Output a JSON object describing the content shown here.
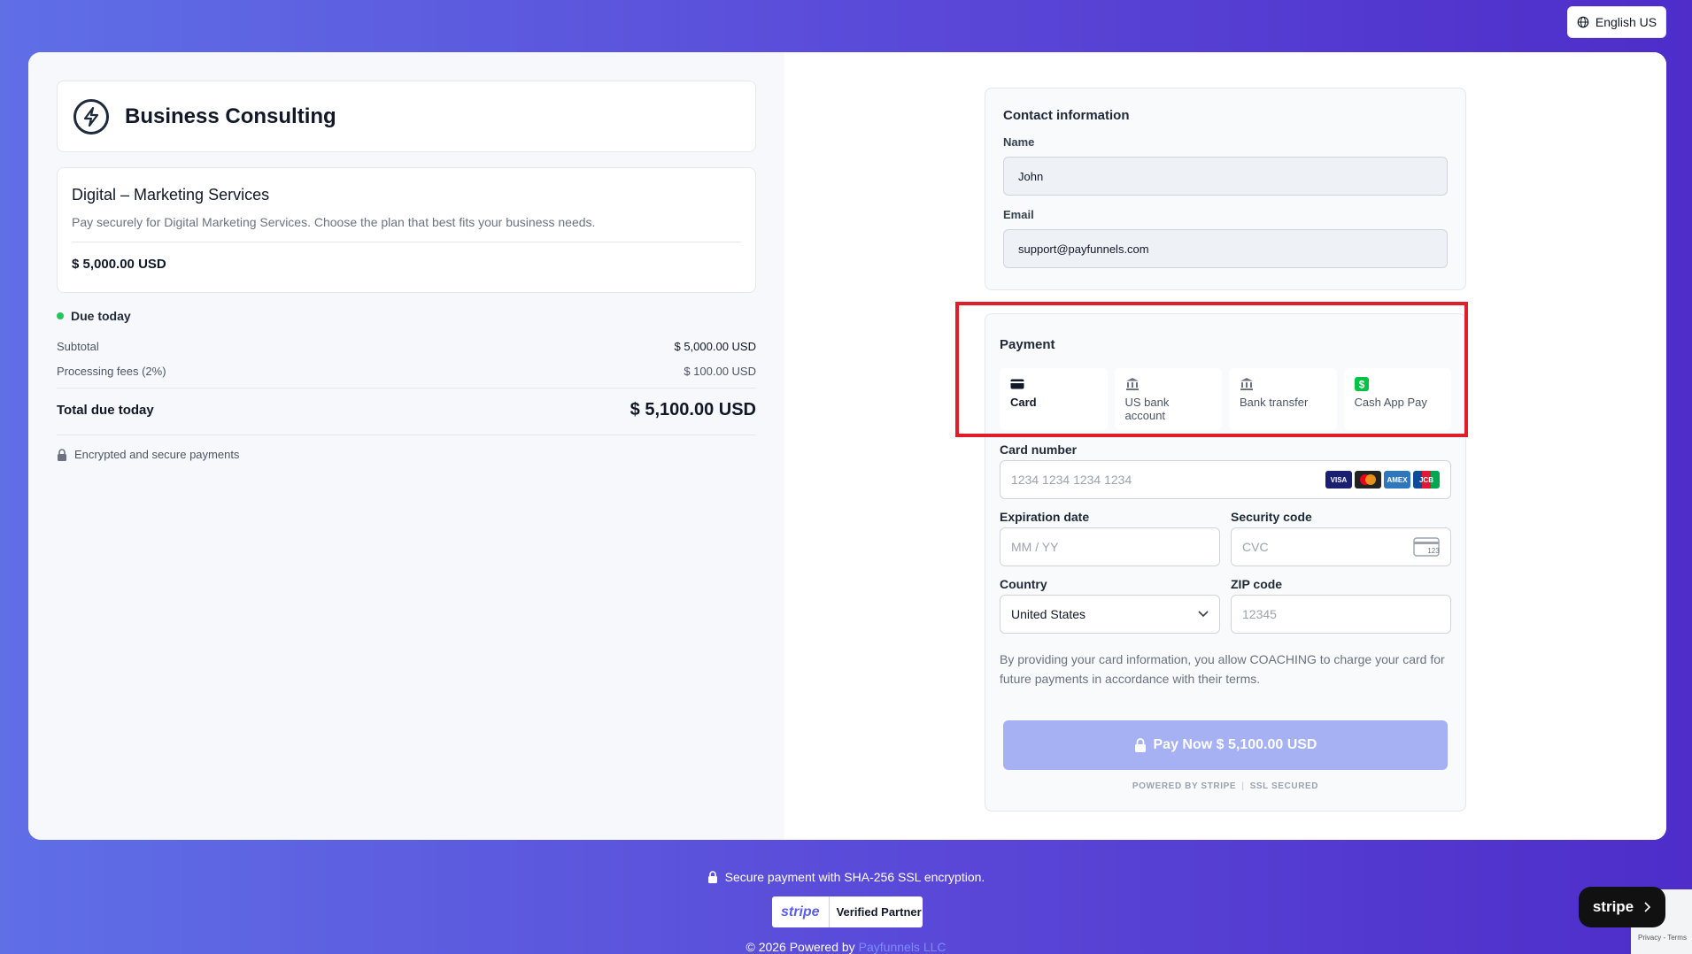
{
  "lang": {
    "label": "English US"
  },
  "brand": {
    "title": "Business Consulting"
  },
  "product": {
    "title": "Digital – Marketing Services",
    "description": "Pay securely for Digital Marketing Services. Choose the plan that best fits your business needs.",
    "price": "$ 5,000.00 USD"
  },
  "summary": {
    "due_label": "Due today",
    "subtotal_label": "Subtotal",
    "subtotal_value": "$ 5,000.00 USD",
    "fees_label": "Processing fees (2%)",
    "fees_value": "$ 100.00 USD",
    "total_label": "Total due today",
    "total_value": "$ 5,100.00 USD",
    "secure_note": "Encrypted and secure payments"
  },
  "contact": {
    "title": "Contact information",
    "name_label": "Name",
    "name_value": "John",
    "email_label": "Email",
    "email_value": "support@payfunnels.com"
  },
  "payment": {
    "title": "Payment",
    "tabs": [
      {
        "label": "Card",
        "icon": "card-icon"
      },
      {
        "label": "US bank account",
        "icon": "bank-icon"
      },
      {
        "label": "Bank transfer",
        "icon": "bank-icon"
      },
      {
        "label": "Cash App Pay",
        "icon": "cash-app-icon"
      }
    ],
    "card_number_label": "Card number",
    "card_number_placeholder": "1234 1234 1234 1234",
    "card_brands": [
      "VISA",
      "MC",
      "AMEX",
      "JCB"
    ],
    "expiry_label": "Expiration date",
    "expiry_placeholder": "MM / YY",
    "cvc_label": "Security code",
    "cvc_placeholder": "CVC",
    "country_label": "Country",
    "country_value": "United States",
    "zip_label": "ZIP code",
    "zip_placeholder": "12345",
    "consent": "By providing your card information, you allow COACHING to charge your card for future payments in accordance with their terms.",
    "pay_button": "Pay Now $ 5,100.00 USD",
    "powered_left": "POWERED BY STRIPE",
    "powered_right": "SSL SECURED"
  },
  "footer": {
    "secure": "Secure payment with SHA-256 SSL encryption.",
    "partner_brand": "stripe",
    "partner_label": "Verified Partner",
    "copy": "© 2026 Powered by",
    "copy_link": "Payfunnels LLC",
    "stripe_badge": "stripe",
    "recaptcha": "Privacy - Terms"
  },
  "colors": {
    "accent": "#5b5fe8",
    "pay_button": "#a5b1f2",
    "highlight": "#e11d2a",
    "success": "#22c55e"
  }
}
